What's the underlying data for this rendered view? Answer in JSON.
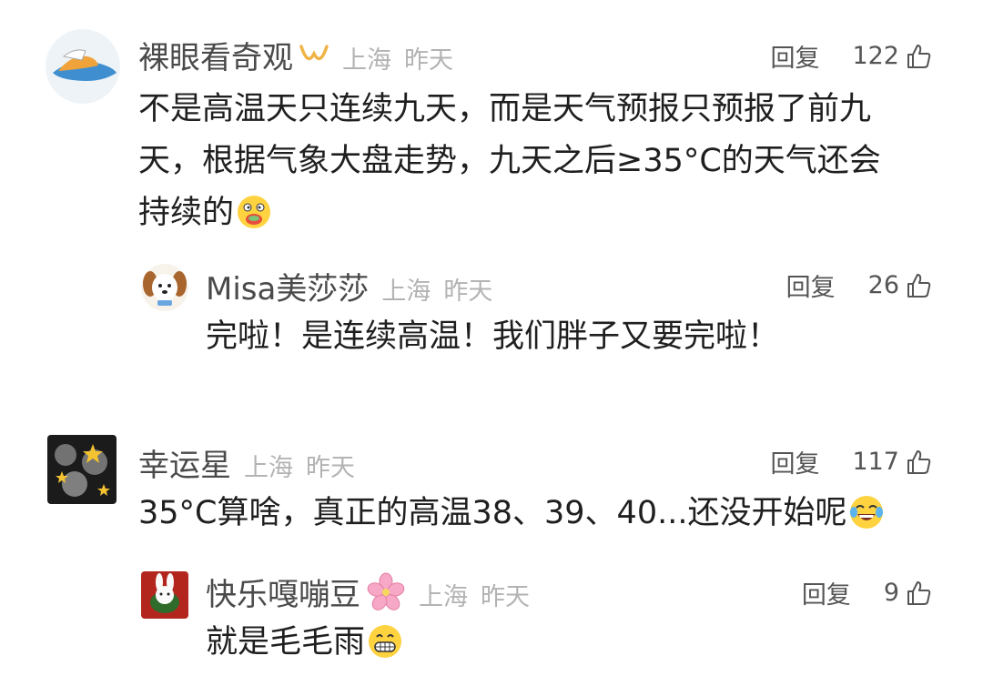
{
  "comments": [
    {
      "username": "裸眼看奇观",
      "location": "上海",
      "time": "昨天",
      "reply_label": "回复",
      "likes": "122",
      "text_lines": [
        "不是高温天只连续九天，而是天气预报只预报了前九",
        "天，根据气象大盘走势，九天之后≥35°C的天气还会",
        "持续的"
      ],
      "badge_icon": "vip-badge-icon",
      "emoji": "sweating-eating-emoji"
    },
    {
      "username": "Misa美莎莎",
      "location": "上海",
      "time": "昨天",
      "reply_label": "回复",
      "likes": "26",
      "text": "完啦！是连续高温！我们胖子又要完啦！"
    },
    {
      "username": "幸运星",
      "location": "上海",
      "time": "昨天",
      "reply_label": "回复",
      "likes": "117",
      "text": "35°C算啥，真正的高温38、39、40...还没开始呢",
      "emoji": "laughing-tears-emoji"
    },
    {
      "username": "快乐嘎嘣豆",
      "location": "上海",
      "time": "昨天",
      "reply_label": "回复",
      "likes": "9",
      "text": "就是毛毛雨",
      "badge_icon": "cherry-blossom-icon",
      "emoji": "grinning-teeth-emoji"
    }
  ],
  "colors": {
    "username": "#4a4a4a",
    "meta": "#b3b3b3",
    "text": "#1f1f1f",
    "action": "#555555"
  }
}
